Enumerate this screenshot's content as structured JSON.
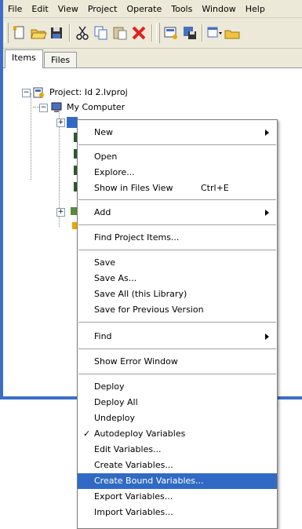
{
  "menubar": {
    "items": [
      "File",
      "Edit",
      "View",
      "Project",
      "Operate",
      "Tools",
      "Window",
      "Help"
    ]
  },
  "tabs": [
    {
      "label": "Items",
      "active": true
    },
    {
      "label": "Files",
      "active": false
    }
  ],
  "tree": {
    "project_label": "Project: Id 2.lvproj",
    "computer_label": "My Computer"
  },
  "context_menu": {
    "new": "New",
    "open": "Open",
    "explore": "Explore...",
    "show_in_files_view": "Show in Files View",
    "show_in_files_view_shortcut": "Ctrl+E",
    "add": "Add",
    "find_project_items": "Find Project Items...",
    "save": "Save",
    "save_as": "Save As...",
    "save_all": "Save All (this Library)",
    "save_previous": "Save for Previous Version",
    "find": "Find",
    "show_error_window": "Show Error Window",
    "deploy": "Deploy",
    "deploy_all": "Deploy All",
    "undeploy": "Undeploy",
    "autodeploy_variables": "Autodeploy Variables",
    "autodeploy_check": "✓",
    "edit_variables": "Edit Variables...",
    "create_variables": "Create Variables...",
    "create_bound_variables": "Create Bound Variables...",
    "export_variables": "Export Variables...",
    "import_variables": "Import Variables..."
  },
  "colors": {
    "highlight": "#316ac5",
    "window_frame": "#3c6ec8",
    "face": "#ece9d8"
  }
}
